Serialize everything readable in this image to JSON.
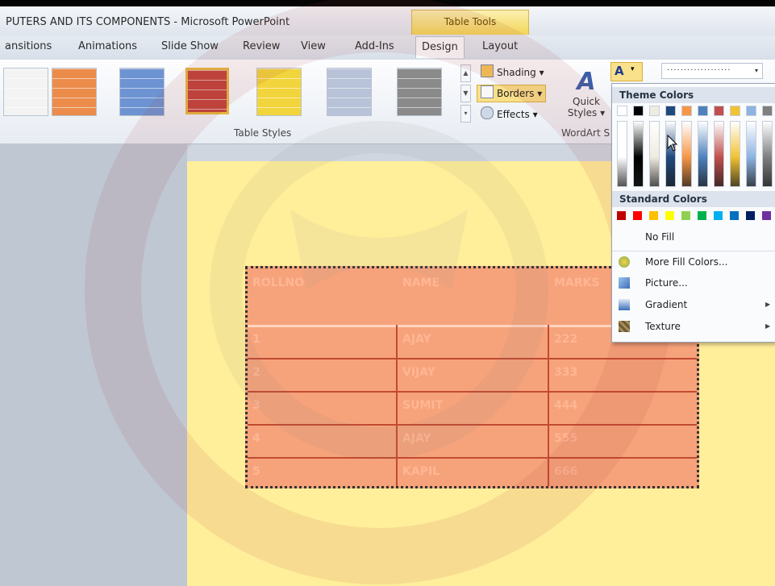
{
  "window": {
    "title": "PUTERS AND ITS COMPONENTS - Microsoft PowerPoint",
    "contextual_tab": "Table Tools"
  },
  "tabs": [
    "ansitions",
    "Animations",
    "Slide Show",
    "Review",
    "View",
    "Add-Ins",
    "Design",
    "Layout"
  ],
  "active_tab": "Design",
  "ribbon": {
    "table_styles_label": "Table Styles",
    "shading": "Shading",
    "borders": "Borders",
    "effects": "Effects",
    "quick_styles_line1": "Quick",
    "quick_styles_line2": "Styles",
    "wordart_label": "WordArt S",
    "fill_letter": "A",
    "pen_style": "···················",
    "style_swatch_colors": [
      "#f3f3f3",
      "#ec8c4b",
      "#6e93d2",
      "#c0453d",
      "#f2d43c",
      "#b8c2d8",
      "#8a8a8a"
    ],
    "selected_swatch": 3
  },
  "table": {
    "headers": [
      "ROLLNO",
      "NAME",
      "MARKS"
    ],
    "rows": [
      [
        "1",
        "AJAY",
        "222"
      ],
      [
        "2",
        "VIJAY",
        "333"
      ],
      [
        "3",
        "SUMIT",
        "444"
      ],
      [
        "4",
        "AJAY",
        "555"
      ],
      [
        "5",
        "KAPIL",
        "666"
      ]
    ]
  },
  "dropdown": {
    "theme_colors_label": "Theme Colors",
    "standard_colors_label": "Standard Colors",
    "theme_colors": [
      "#ffffff",
      "#000000",
      "#eeece1",
      "#1f497d",
      "#f79646",
      "#4f81bd",
      "#c0504d",
      "#f1c232",
      "#8db3e2",
      "#7f7f7f"
    ],
    "standard_colors": [
      "#c00000",
      "#ff0000",
      "#ffc000",
      "#ffff00",
      "#92d050",
      "#00b050",
      "#00b0f0",
      "#0070c0",
      "#002060",
      "#7030a0"
    ],
    "no_fill": "No Fill",
    "more_fill_colors": "More Fill Colors...",
    "picture": "Picture...",
    "gradient": "Gradient",
    "texture": "Texture"
  }
}
